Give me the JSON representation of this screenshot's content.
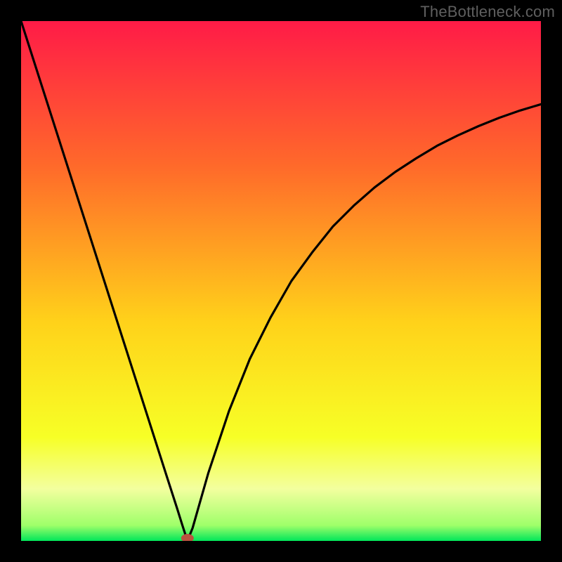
{
  "watermark": "TheBottleneck.com",
  "colors": {
    "frame": "#000000",
    "gradient_top": "#ff1b47",
    "gradient_mid_upper": "#ff6a2a",
    "gradient_mid": "#ffd21a",
    "gradient_mid_lower": "#f7ff26",
    "gradient_band": "#f3ff9f",
    "gradient_bottom": "#00e65a",
    "curve": "#000000",
    "marker": "#b9533f"
  },
  "chart_data": {
    "type": "line",
    "title": "",
    "xlabel": "",
    "ylabel": "",
    "xlim": [
      0,
      100
    ],
    "ylim": [
      0,
      100
    ],
    "minimum_x": 32,
    "series": [
      {
        "name": "bottleneck-curve",
        "x": [
          0,
          4,
          8,
          12,
          16,
          20,
          24,
          28,
          30,
          31,
          32,
          33,
          34,
          36,
          38,
          40,
          44,
          48,
          52,
          56,
          60,
          64,
          68,
          72,
          76,
          80,
          84,
          88,
          92,
          96,
          100
        ],
        "y": [
          100,
          87.5,
          75,
          62.5,
          50,
          37.5,
          25,
          12.5,
          6.3,
          3.1,
          0,
          2.5,
          6,
          13,
          19,
          25,
          35,
          43,
          50,
          55.5,
          60.5,
          64.5,
          68,
          71,
          73.6,
          76,
          78,
          79.8,
          81.4,
          82.8,
          84
        ]
      }
    ],
    "annotations": [
      {
        "name": "minimum-marker",
        "x": 32,
        "y": 0
      }
    ]
  }
}
